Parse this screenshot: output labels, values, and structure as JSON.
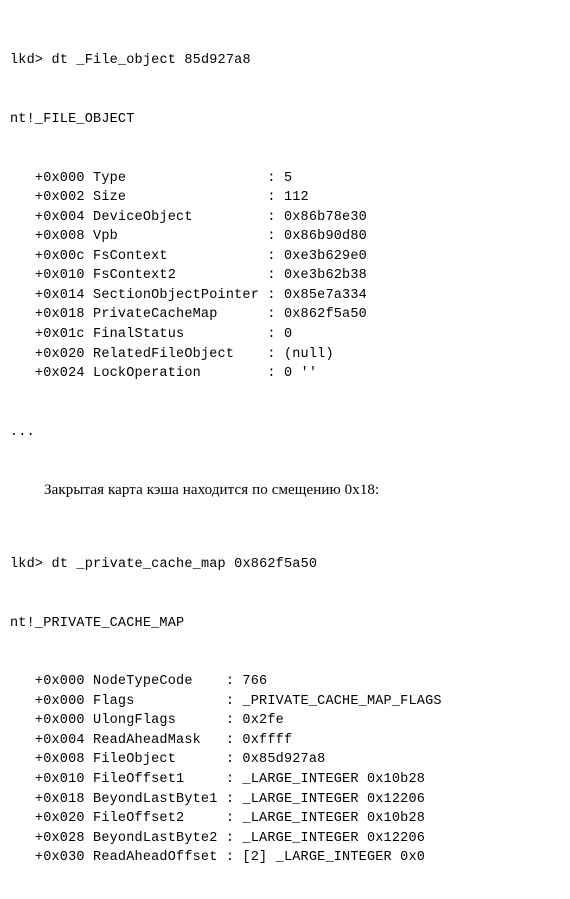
{
  "block1": {
    "prompt": "lkd>",
    "command": "dt _File_object 85d927a8",
    "header": "nt!_FILE_OBJECT",
    "fields": [
      {
        "offset": "+0x000",
        "name": "Type",
        "value": "5"
      },
      {
        "offset": "+0x002",
        "name": "Size",
        "value": "112"
      },
      {
        "offset": "+0x004",
        "name": "DeviceObject",
        "value": "0x86b78e30"
      },
      {
        "offset": "+0x008",
        "name": "Vpb",
        "value": "0x86b90d80"
      },
      {
        "offset": "+0x00c",
        "name": "FsContext",
        "value": "0xe3b629e0"
      },
      {
        "offset": "+0x010",
        "name": "FsContext2",
        "value": "0xe3b62b38"
      },
      {
        "offset": "+0x014",
        "name": "SectionObjectPointer",
        "value": "0x85e7a334"
      },
      {
        "offset": "+0x018",
        "name": "PrivateCacheMap",
        "value": "0x862f5a50"
      },
      {
        "offset": "+0x01c",
        "name": "FinalStatus",
        "value": "0"
      },
      {
        "offset": "+0x020",
        "name": "RelatedFileObject",
        "value": "(null)"
      },
      {
        "offset": "+0x024",
        "name": "LockOperation",
        "value": "0 ''"
      }
    ],
    "ellipsis": "..."
  },
  "prose_line": "Закрытая карта кэша находится по смещению 0x18:",
  "block2": {
    "prompt": "lkd>",
    "command": "dt _private_cache_map 0x862f5a50",
    "header": "nt!_PRIVATE_CACHE_MAP",
    "fields": [
      {
        "offset": "+0x000",
        "name": "NodeTypeCode",
        "value": "766"
      },
      {
        "offset": "+0x000",
        "name": "Flags",
        "value": "_PRIVATE_CACHE_MAP_FLAGS"
      },
      {
        "offset": "+0x000",
        "name": "UlongFlags",
        "value": "0x2fe"
      },
      {
        "offset": "+0x004",
        "name": "ReadAheadMask",
        "value": "0xffff"
      },
      {
        "offset": "+0x008",
        "name": "FileObject",
        "value": "0x85d927a8"
      },
      {
        "offset": "+0x010",
        "name": "FileOffset1",
        "value": "_LARGE_INTEGER 0x10b28"
      },
      {
        "offset": "+0x018",
        "name": "BeyondLastByte1",
        "value": "_LARGE_INTEGER 0x12206"
      },
      {
        "offset": "+0x020",
        "name": "FileOffset2",
        "value": "_LARGE_INTEGER 0x10b28"
      },
      {
        "offset": "+0x028",
        "name": "BeyondLastByte2",
        "value": "_LARGE_INTEGER 0x12206"
      },
      {
        "offset": "+0x030",
        "name": "ReadAheadOffset",
        "value": "[2] _LARGE_INTEGER 0x0"
      }
    ]
  },
  "layout": {
    "indent_fields": "   ",
    "name_col_width_b1": 20,
    "name_col_width_b2": 15
  }
}
